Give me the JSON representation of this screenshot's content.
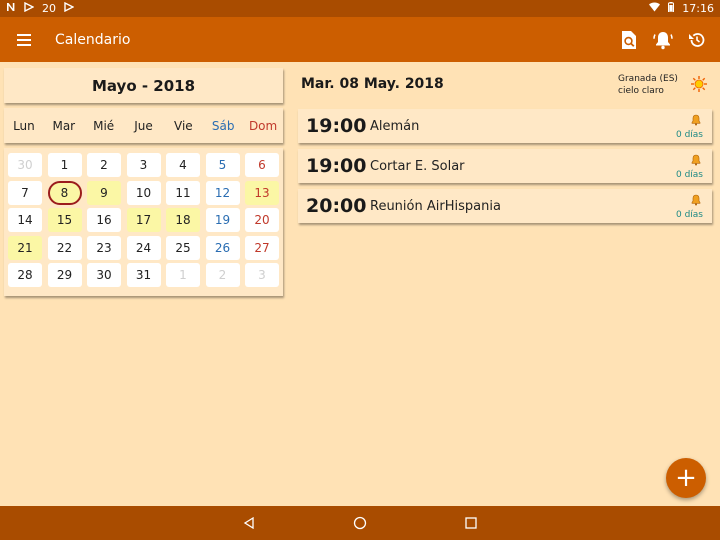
{
  "status_bar": {
    "notification_count": "20",
    "time": "17:16"
  },
  "app_bar": {
    "title": "Calendario"
  },
  "calendar": {
    "month_label": "Mayo - 2018",
    "weekdays": [
      "Lun",
      "Mar",
      "Mié",
      "Jue",
      "Vie",
      "Sáb",
      "Dom"
    ],
    "weeks": [
      [
        "30",
        "1",
        "2",
        "3",
        "4",
        "5",
        "6"
      ],
      [
        "7",
        "8",
        "9",
        "10",
        "11",
        "12",
        "13"
      ],
      [
        "14",
        "15",
        "16",
        "17",
        "18",
        "19",
        "20"
      ],
      [
        "21",
        "22",
        "23",
        "24",
        "25",
        "26",
        "27"
      ],
      [
        "28",
        "29",
        "30",
        "31",
        "1",
        "2",
        "3"
      ]
    ]
  },
  "day_view": {
    "date_label": "Mar. 08 May. 2018",
    "weather_location": "Granada (ES)",
    "weather_condition": "cielo claro",
    "events": [
      {
        "time": "19:00",
        "title": "Alemán",
        "reminder": "0 días"
      },
      {
        "time": "19:00",
        "title": "Cortar E. Solar",
        "reminder": "0 días"
      },
      {
        "time": "20:00",
        "title": "Reunión AirHispania",
        "reminder": "0 días"
      }
    ]
  },
  "fab": {
    "label": "+"
  },
  "colors": {
    "app_bar": "#cc5e00",
    "background": "#ffe2b5",
    "event_day": "#fbf7a5",
    "today_ring": "#9b1c1c",
    "saturday": "#2a6db2",
    "sunday": "#c0392b",
    "reminder_text": "#1e8a86"
  },
  "icons": [
    "menu-icon",
    "search-icon",
    "bell-icon",
    "sync-icon",
    "sun-icon",
    "back-icon",
    "home-icon",
    "recents-icon"
  ]
}
